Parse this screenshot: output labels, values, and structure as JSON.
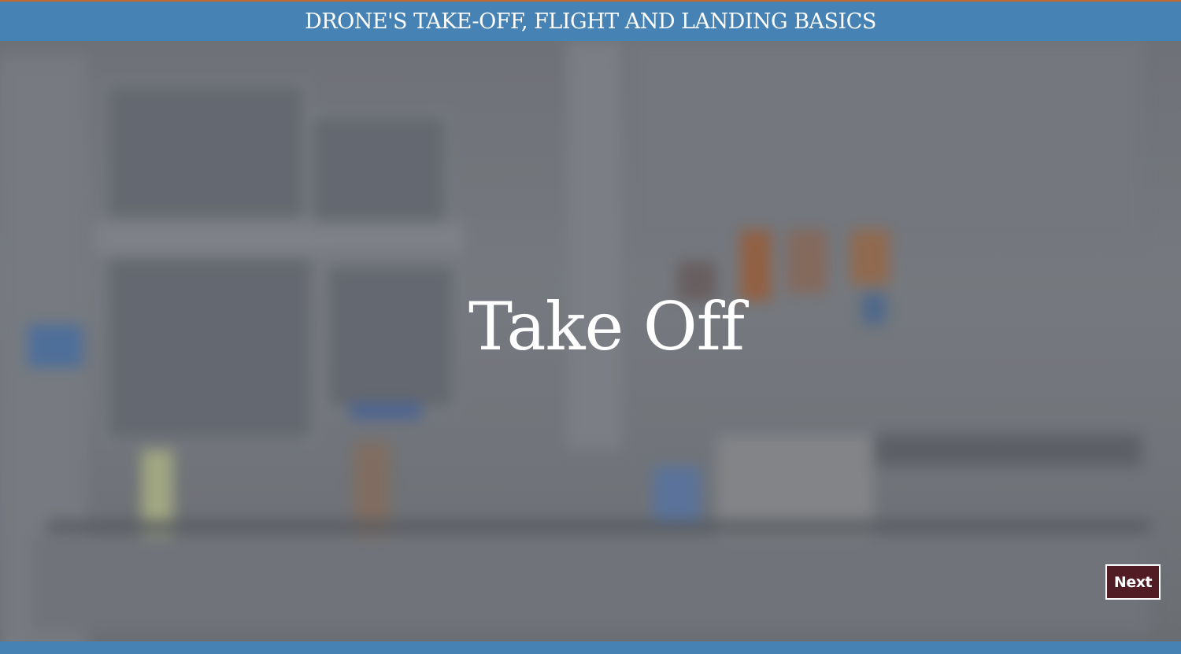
{
  "header": {
    "title": "DRONE'S TAKE-OFF, FLIGHT AND LANDING BASICS"
  },
  "slide": {
    "heading": "Take Off"
  },
  "navigation": {
    "next_label": "Next"
  },
  "colors": {
    "title_bar": "#4682b4",
    "top_accent": "#c46a2a",
    "next_button": "#521c24",
    "background": "#6e7176"
  }
}
